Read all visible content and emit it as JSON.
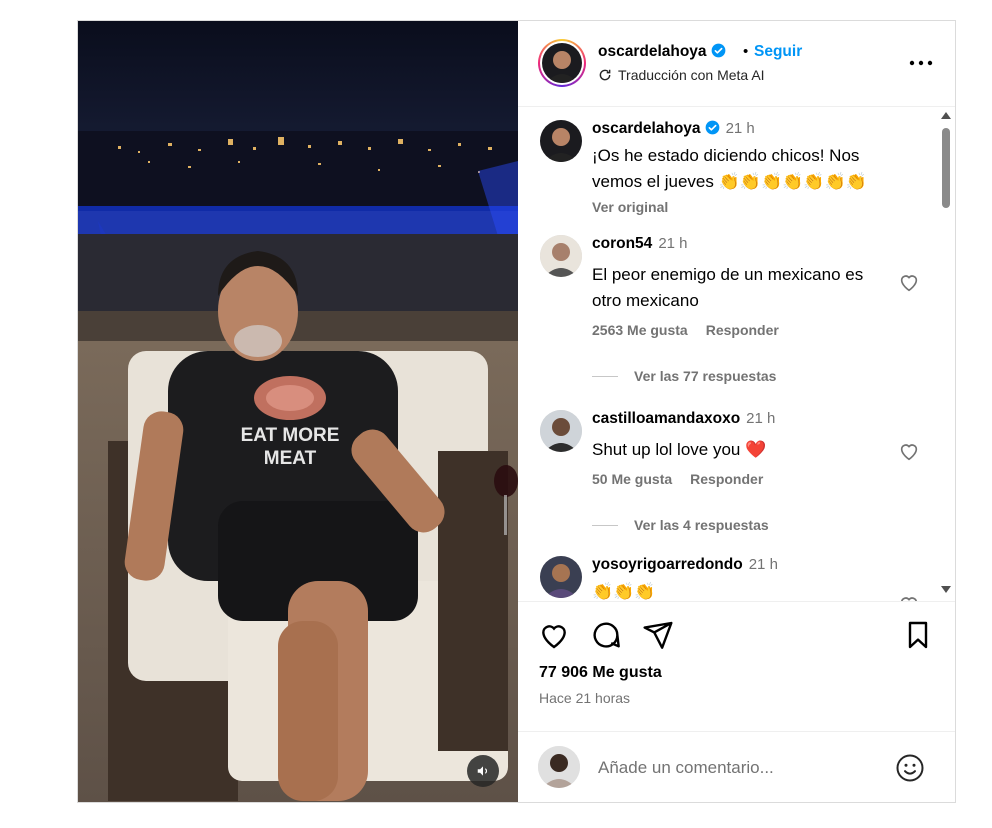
{
  "colors": {
    "accent": "#0095f6",
    "like_heart": "#ff3040",
    "muted": "#737373"
  },
  "post": {
    "media": {
      "shirt_text_line1": "EAT MORE",
      "shirt_text_line2": "MEAT",
      "sound_icon": "volume-icon"
    },
    "header": {
      "username": "oscardelahoya",
      "dot": "•",
      "follow_label": "Seguir",
      "subtitle": "Traducción con Meta AI"
    },
    "caption": {
      "username": "oscardelahoya",
      "time": "21 h",
      "text": "¡Os he estado diciendo chicos! Nos vemos el jueves 👏👏👏👏👏👏👏",
      "see_original": "Ver original"
    },
    "comments": [
      {
        "username": "coron54",
        "time": "21 h",
        "text": "El peor enemigo de un mexicano es otro mexicano",
        "likes": "2563 Me gusta",
        "reply": "Responder",
        "view_replies": "Ver las 77 respuestas"
      },
      {
        "username": "castilloamandaxoxo",
        "time": "21 h",
        "text": "Shut up lol love you ❤️",
        "likes": "50 Me gusta",
        "reply": "Responder",
        "view_replies": "Ver las 4 respuestas"
      },
      {
        "username": "yosoyrigoarredondo",
        "time": "21 h",
        "text": "👏👏👏"
      }
    ],
    "likes_count": "77 906 Me gusta",
    "posted_ago": "Hace 21 horas",
    "add_comment": {
      "placeholder": "Añade un comentario..."
    }
  }
}
